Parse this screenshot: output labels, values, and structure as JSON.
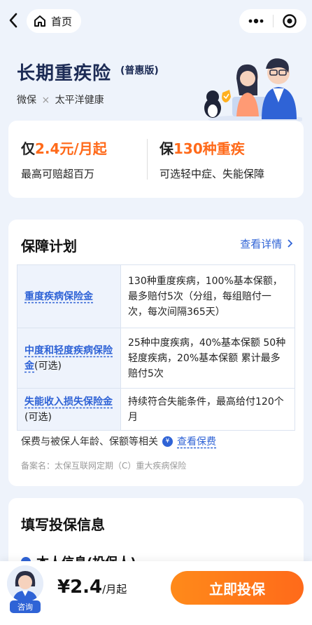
{
  "nav": {
    "home_label": "首页",
    "back_icon": "chevron-left-icon",
    "home_icon": "home-icon",
    "more_icon": "more-dots-icon",
    "close_icon": "target-close-icon"
  },
  "hero": {
    "title": "长期重疾险",
    "tag": "(普惠版)",
    "brand_left": "微保",
    "brand_sep": "×",
    "brand_right": "太平洋健康"
  },
  "price_card": {
    "left_prefix": "仅",
    "left_highlight": "2.4元/月起",
    "left_sub": "最高可赔超百万",
    "right_prefix": "保",
    "right_highlight": "130种重疾",
    "right_sub": "可选轻中症、失能保障"
  },
  "plan": {
    "title": "保障计划",
    "detail_link": "查看详情",
    "rows": [
      {
        "name": "重度疾病保险金",
        "optional": "",
        "desc": "130种重度疾病，100%基本保额，最多赔付5次（分组，每组赔付一次，每次间隔365天）"
      },
      {
        "name": "中度和轻度疾病保险金",
        "optional": "(可选)",
        "desc": "25种中度疾病，40%基本保额 50种轻度疾病，20%基本保额 累计最多赔付5次"
      },
      {
        "name": "失能收入损失保险金",
        "optional": "(可选)",
        "desc": "持续符合失能条件，最高给付120个月"
      }
    ],
    "premium_note": "保费与被保人年龄、保额等相关",
    "premium_link": "查看保费",
    "filing": "备案名：太保互联网定期（C）重大疾病保险"
  },
  "info": {
    "title": "填写投保信息",
    "subtitle": "本人信息(投保人)"
  },
  "bottom": {
    "consult": "咨询",
    "price": "¥2.4",
    "unit": "/月起",
    "cta": "立即投保"
  },
  "colors": {
    "accent": "#2f63d6",
    "orange": "#ff6a1a",
    "background": "#eef3fb"
  }
}
